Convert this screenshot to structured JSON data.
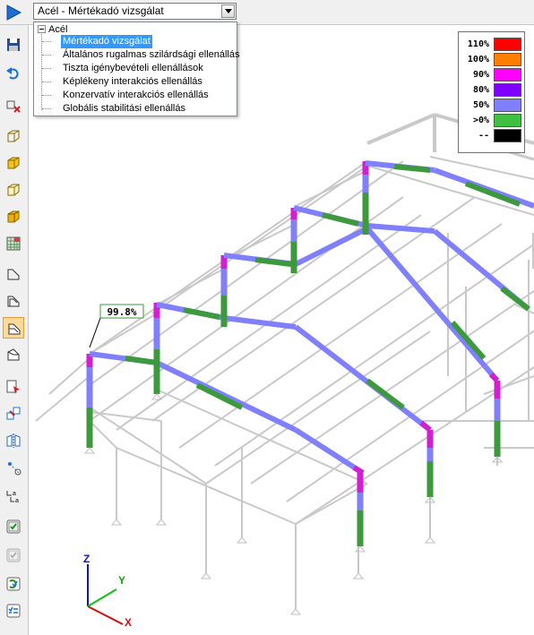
{
  "topbar": {
    "combo_value": "Acél - Mértékadó vizsgálat"
  },
  "dropdown": {
    "root": "Acél",
    "items": [
      "Mértékadó vizsgálat",
      "Általános rugalmas szilárdsági ellenállás",
      "Tiszta igénybevételi ellenállások",
      "Képlékeny interakciós ellenállás",
      "Konzervatív interakciós ellenállás",
      "Globális stabilitási ellenállás"
    ],
    "selected_index": 0
  },
  "legend": [
    {
      "label": "110%",
      "color": "#ff0000"
    },
    {
      "label": "100%",
      "color": "#ff8000"
    },
    {
      "label": "90%",
      "color": "#ff00ff"
    },
    {
      "label": "80%",
      "color": "#8000ff"
    },
    {
      "label": "50%",
      "color": "#8080ff"
    },
    {
      "label": ">0%",
      "color": "#40c040"
    },
    {
      "label": "--",
      "color": "#000000"
    }
  ],
  "viewport": {
    "max_label": "99.8%"
  },
  "axes": {
    "x": "X",
    "y": "Y",
    "z": "Z"
  },
  "toolbar_icons": [
    "save-icon",
    "undo-icon",
    "section-icon",
    "wireframe-icon",
    "solid-icon",
    "hidden-line-icon",
    "render-icon",
    "mesh-icon",
    "profile-icon",
    "profile-outline-icon",
    "profile-solid-icon",
    "profile-half-icon",
    "cursor-select-icon",
    "transform-icon",
    "mirror-icon",
    "node-icon",
    "label-icon",
    "check-icon",
    "check-disabled-icon",
    "check-refresh-icon",
    "check-list-icon"
  ]
}
